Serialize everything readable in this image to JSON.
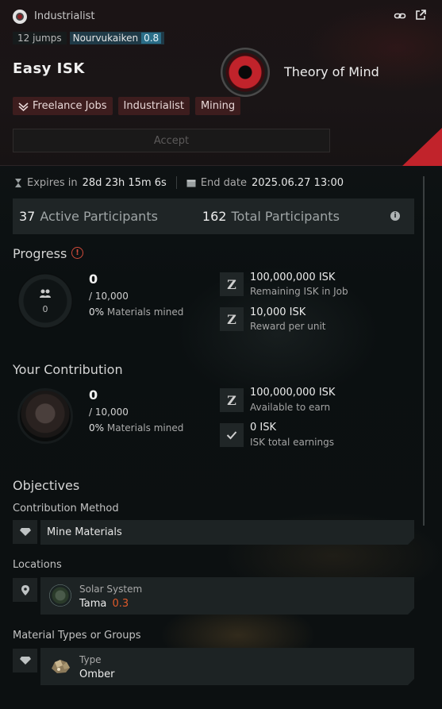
{
  "header": {
    "corp": "Industrialist",
    "jumps": "12 jumps",
    "system": "Nourvukaiken",
    "security": "0.8",
    "title": "Easy ISK",
    "owner": "Theory of Mind",
    "tags": [
      "Freelance Jobs",
      "Industrialist",
      "Mining"
    ],
    "accept_label": "Accept"
  },
  "meta": {
    "expires_label": "Expires in",
    "expires_value": "28d 23h 15m 6s",
    "end_label": "End date",
    "end_value": "2025.06.27 13:00"
  },
  "participants": {
    "active_count": "37",
    "active_label": "Active Participants",
    "total_count": "162",
    "total_label": "Total Participants"
  },
  "progress": {
    "title": "Progress",
    "ring_value": "0",
    "amount": "0",
    "of_total": "/ 10,000",
    "pct": "0%",
    "pct_label": "Materials mined",
    "remaining_value": "100,000,000 ISK",
    "remaining_label": "Remaining ISK in Job",
    "reward_value": "10,000 ISK",
    "reward_label": "Reward per unit"
  },
  "contribution": {
    "title": "Your Contribution",
    "amount": "0",
    "of_total": "/ 10,000",
    "pct": "0%",
    "pct_label": "Materials mined",
    "available_value": "100,000,000 ISK",
    "available_label": "Available to earn",
    "earned_value": "0 ISK",
    "earned_label": "ISK total earnings"
  },
  "objectives": {
    "title": "Objectives",
    "method_label": "Contribution Method",
    "method_value": "Mine Materials",
    "locations_label": "Locations",
    "location_type": "Solar System",
    "location_name": "Tama",
    "location_security": "0.3",
    "materials_label": "Material Types or Groups",
    "material_type_label": "Type",
    "material_name": "Omber"
  },
  "colors": {
    "accent_red": "#c1232b",
    "security_high": "#2b6e88",
    "security_low": "#e05a2a"
  }
}
